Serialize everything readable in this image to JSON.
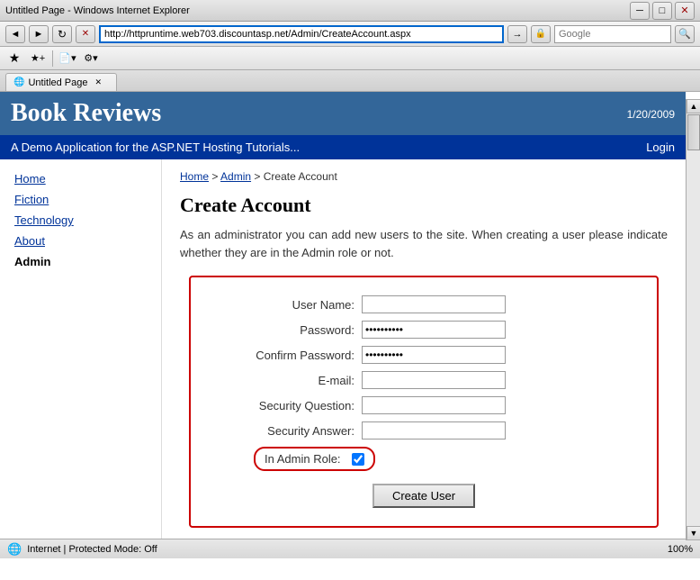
{
  "browser": {
    "title": "Untitled Page - Windows Internet Explorer",
    "address": "http://httpruntime.web703.discountasp.net/Admin/CreateAccount.aspx",
    "tab_label": "Untitled Page",
    "search_placeholder": "Google",
    "back_label": "◄",
    "forward_label": "►",
    "go_label": "→",
    "refresh_label": "↻",
    "stop_label": "✕"
  },
  "site": {
    "title": "Book Reviews",
    "date": "1/20/2009",
    "tagline": "A Demo Application for the ASP.NET Hosting Tutorials...",
    "login_label": "Login"
  },
  "sidebar": {
    "items": [
      {
        "label": "Home",
        "active": false
      },
      {
        "label": "Fiction",
        "active": false
      },
      {
        "label": "Technology",
        "active": false
      },
      {
        "label": "About",
        "active": false
      },
      {
        "label": "Admin",
        "active": true
      }
    ]
  },
  "breadcrumb": {
    "home": "Home",
    "sep1": " > ",
    "admin": "Admin",
    "sep2": " > ",
    "current": "Create Account"
  },
  "content": {
    "heading": "Create Account",
    "description": "As an administrator you can add new users to the site. When creating a user please indicate whether they are in the Admin role or not."
  },
  "form": {
    "username_label": "User Name:",
    "password_label": "Password:",
    "confirm_password_label": "Confirm Password:",
    "email_label": "E-mail:",
    "security_question_label": "Security Question:",
    "security_answer_label": "Security Answer:",
    "admin_role_label": "In Admin Role:",
    "password_value": "••••••••••",
    "confirm_password_value": "••••••••••",
    "create_button_label": "Create User"
  },
  "statusbar": {
    "zone": "Internet | Protected Mode: Off",
    "zoom": "100%"
  }
}
